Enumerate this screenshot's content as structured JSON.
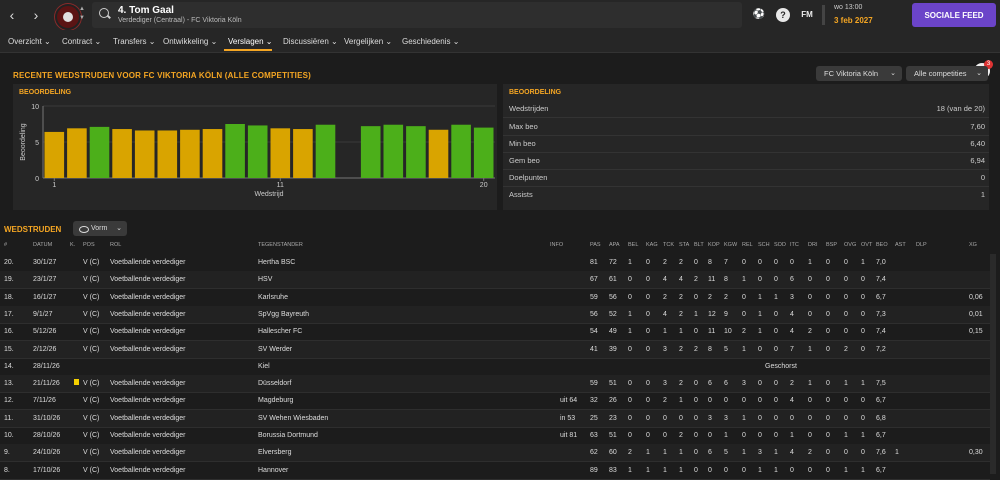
{
  "topbar": {
    "back_icon": "chevron-left-icon",
    "forward_icon": "chevron-right-icon",
    "player_title": "4. Tom Gaal",
    "player_subtitle": "Verdediger (Centraal) - FC Viktoria Köln",
    "help_label": "?",
    "fm_label": "FM",
    "time": "wo 13:00",
    "date": "3 feb 2027",
    "social_button": "SOCIALE FEED"
  },
  "menu": [
    {
      "label": "Overzicht ⌄"
    },
    {
      "label": "Contract ⌄"
    },
    {
      "label": "Transfers ⌄"
    },
    {
      "label": "Ontwikkeling ⌄"
    },
    {
      "label": "Verslagen ⌄"
    },
    {
      "label": "Discussiëren ⌄"
    },
    {
      "label": "Vergelijken ⌄"
    },
    {
      "label": "Geschiedenis ⌄"
    }
  ],
  "notification_count": "3",
  "section": {
    "title": "RECENTE WEDSTRUDEN VOOR FC VIKTORIA KÖLN (ALLE COMPETITIES)",
    "club_dropdown": "FC Viktoria Köln",
    "comp_dropdown": "Alle competities"
  },
  "chart_panel": {
    "title": "BEOORDELING"
  },
  "chart_data": {
    "type": "bar",
    "title": "BEOORDELING",
    "xlabel": "Wedstrijd",
    "ylabel": "Beoordeling",
    "ylim": [
      0,
      10
    ],
    "yticks": [
      0,
      5,
      10
    ],
    "xticks": [
      "1",
      "11",
      "20"
    ],
    "x": [
      1,
      2,
      3,
      4,
      5,
      6,
      7,
      8,
      9,
      10,
      11,
      12,
      13,
      14,
      15,
      16,
      17,
      18,
      19,
      20
    ],
    "values": [
      6.4,
      6.9,
      7.1,
      6.8,
      6.6,
      6.6,
      6.7,
      6.8,
      7.5,
      7.3,
      6.9,
      6.8,
      7.4,
      null,
      7.2,
      7.4,
      7.2,
      6.7,
      7.4,
      7.0
    ],
    "colors": {
      "good": "#4caf1a",
      "average": "#d9a400"
    },
    "series_color": [
      "average",
      "average",
      "good",
      "average",
      "average",
      "average",
      "average",
      "average",
      "good",
      "good",
      "average",
      "average",
      "good",
      null,
      "good",
      "good",
      "good",
      "average",
      "good",
      "good"
    ]
  },
  "stats_panel": {
    "title": "BEOORDELING",
    "rows": [
      {
        "label": "Wedstrijden",
        "value": "18 (van de 20)"
      },
      {
        "label": "Max beo",
        "value": "7,60"
      },
      {
        "label": "Min beo",
        "value": "6,40"
      },
      {
        "label": "Gem beo",
        "value": "6,94"
      },
      {
        "label": "Doelpunten",
        "value": "0"
      },
      {
        "label": "Assists",
        "value": "1"
      }
    ]
  },
  "matches": {
    "title": "WEDSTRUDEN",
    "view_dropdown": "Vorm",
    "columns": [
      "#",
      "DATUM",
      "K.",
      "POS",
      "ROL",
      "TEGENSTANDER",
      "INFO",
      "PAS",
      "APA",
      "BEL",
      "KAG",
      "TCK",
      "STA",
      "BLT",
      "KOP",
      "KGW",
      "REL",
      "SCH",
      "SOD",
      "ITC",
      "DRI",
      "BSP",
      "OVG",
      "OVT",
      "BEO",
      "AST",
      "DLP",
      "XG"
    ],
    "rows": [
      {
        "n": "20.",
        "date": "30/1/27",
        "card": false,
        "pos": "V (C)",
        "role": "Voetballende verdediger",
        "opp": "Hertha BSC",
        "info": "",
        "stats": [
          "81",
          "72",
          "1",
          "0",
          "2",
          "2",
          "0",
          "8",
          "7",
          "0",
          "0",
          "0",
          "0",
          "1",
          "0",
          "0",
          "1",
          "7,0",
          "",
          "",
          ""
        ]
      },
      {
        "n": "19.",
        "date": "23/1/27",
        "card": false,
        "pos": "V (C)",
        "role": "Voetballende verdediger",
        "opp": "HSV",
        "info": "",
        "stats": [
          "67",
          "61",
          "0",
          "0",
          "4",
          "4",
          "2",
          "11",
          "8",
          "1",
          "0",
          "0",
          "6",
          "0",
          "0",
          "0",
          "0",
          "7,4",
          "",
          "",
          ""
        ]
      },
      {
        "n": "18.",
        "date": "16/1/27",
        "card": false,
        "pos": "V (C)",
        "role": "Voetballende verdediger",
        "opp": "Karlsruhe",
        "info": "",
        "stats": [
          "59",
          "56",
          "0",
          "0",
          "2",
          "2",
          "0",
          "2",
          "2",
          "0",
          "1",
          "1",
          "3",
          "0",
          "0",
          "0",
          "0",
          "6,7",
          "",
          "",
          "0,06"
        ]
      },
      {
        "n": "17.",
        "date": "9/1/27",
        "card": false,
        "pos": "V (C)",
        "role": "Voetballende verdediger",
        "opp": "SpVgg Bayreuth",
        "info": "",
        "stats": [
          "56",
          "52",
          "1",
          "0",
          "4",
          "2",
          "1",
          "12",
          "9",
          "0",
          "1",
          "0",
          "4",
          "0",
          "0",
          "0",
          "0",
          "7,3",
          "",
          "",
          "0,01"
        ]
      },
      {
        "n": "16.",
        "date": "5/12/26",
        "card": false,
        "pos": "V (C)",
        "role": "Voetballende verdediger",
        "opp": "Hallescher FC",
        "info": "",
        "stats": [
          "54",
          "49",
          "1",
          "0",
          "1",
          "1",
          "0",
          "11",
          "10",
          "2",
          "1",
          "0",
          "4",
          "2",
          "0",
          "0",
          "0",
          "7,4",
          "",
          "",
          "0,15"
        ]
      },
      {
        "n": "15.",
        "date": "2/12/26",
        "card": false,
        "pos": "V (C)",
        "role": "Voetballende verdediger",
        "opp": "SV Werder",
        "info": "",
        "stats": [
          "41",
          "39",
          "0",
          "0",
          "3",
          "2",
          "2",
          "8",
          "5",
          "1",
          "0",
          "0",
          "7",
          "1",
          "0",
          "2",
          "0",
          "7,2",
          "",
          "",
          ""
        ]
      },
      {
        "n": "14.",
        "date": "28/11/26",
        "card": false,
        "pos": "",
        "role": "",
        "opp": "Kiel",
        "info": "",
        "note": "Geschorst",
        "stats": []
      },
      {
        "n": "13.",
        "date": "21/11/26",
        "card": true,
        "pos": "V (C)",
        "role": "Voetballende verdediger",
        "opp": "Düsseldorf",
        "info": "",
        "stats": [
          "59",
          "51",
          "0",
          "0",
          "3",
          "2",
          "0",
          "6",
          "6",
          "3",
          "0",
          "0",
          "2",
          "1",
          "0",
          "1",
          "1",
          "7,5",
          "",
          "",
          ""
        ]
      },
      {
        "n": "12.",
        "date": "7/11/26",
        "card": false,
        "pos": "V (C)",
        "role": "Voetballende verdediger",
        "opp": "Magdeburg",
        "info": "uit 64",
        "stats": [
          "32",
          "26",
          "0",
          "0",
          "2",
          "1",
          "0",
          "0",
          "0",
          "0",
          "0",
          "0",
          "4",
          "0",
          "0",
          "0",
          "0",
          "6,7",
          "",
          "",
          ""
        ]
      },
      {
        "n": "11.",
        "date": "31/10/26",
        "card": false,
        "pos": "V (C)",
        "role": "Voetballende verdediger",
        "opp": "SV Wehen Wiesbaden",
        "info": "in 53",
        "stats": [
          "25",
          "23",
          "0",
          "0",
          "0",
          "0",
          "0",
          "3",
          "3",
          "1",
          "0",
          "0",
          "0",
          "0",
          "0",
          "0",
          "0",
          "6,8",
          "",
          "",
          ""
        ]
      },
      {
        "n": "10.",
        "date": "28/10/26",
        "card": false,
        "pos": "V (C)",
        "role": "Voetballende verdediger",
        "opp": "Borussia Dortmund",
        "info": "uit 81",
        "stats": [
          "63",
          "51",
          "0",
          "0",
          "0",
          "2",
          "0",
          "0",
          "1",
          "0",
          "0",
          "0",
          "1",
          "0",
          "0",
          "1",
          "1",
          "6,7",
          "",
          "",
          ""
        ]
      },
      {
        "n": "9.",
        "date": "24/10/26",
        "card": false,
        "pos": "V (C)",
        "role": "Voetballende verdediger",
        "opp": "Elversberg",
        "info": "",
        "stats": [
          "62",
          "60",
          "2",
          "1",
          "1",
          "1",
          "0",
          "6",
          "5",
          "1",
          "3",
          "1",
          "4",
          "2",
          "0",
          "0",
          "0",
          "7,6",
          "1",
          "",
          "0,30"
        ]
      },
      {
        "n": "8.",
        "date": "17/10/26",
        "card": false,
        "pos": "V (C)",
        "role": "Voetballende verdediger",
        "opp": "Hannover",
        "info": "",
        "stats": [
          "89",
          "83",
          "1",
          "1",
          "1",
          "1",
          "0",
          "0",
          "0",
          "0",
          "1",
          "1",
          "0",
          "0",
          "0",
          "1",
          "1",
          "6,7",
          "",
          "",
          ""
        ]
      }
    ]
  }
}
